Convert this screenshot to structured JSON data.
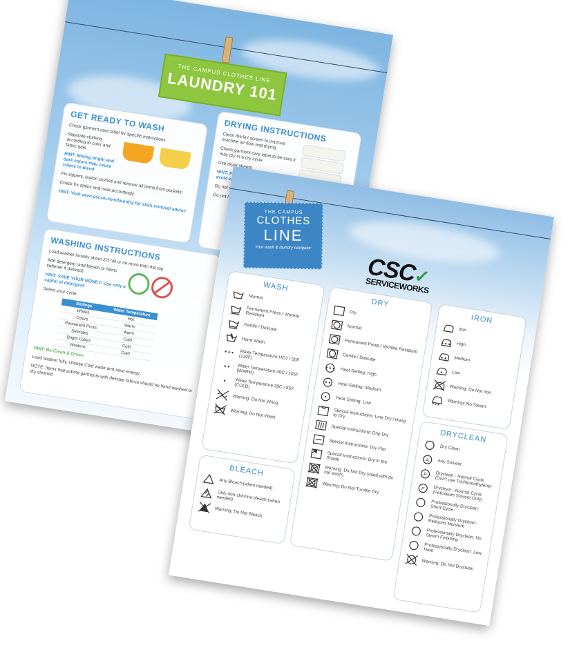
{
  "back_poster": {
    "tag_small": "THE CAMPUS CLOTHES LINE",
    "tag_big": "LAUNDRY 101",
    "get_ready": {
      "title": "GET READY TO WASH",
      "items": [
        "Check garment care label for specific instructions",
        "Separate clothing according to color and fabric type",
        "HINT: Mixing bright and dark colors may cause colors to bleed",
        "Fix zippers, button clothes and remove all items from pockets",
        "Check for stains and treat accordingly",
        "HINT: Visit www.cscsw.com/laundry for stain removal advice"
      ]
    },
    "drying": {
      "title": "DRYING INSTRUCTIONS",
      "items": [
        "Clean the lint screen to improve machine air flow and drying",
        "Check garment care label to be sure it may dry in a dry cycle",
        "Use dryer sheets",
        "HINT: Fold clothes right away to avoid wrinkles",
        "Do not overload the dryer",
        "Do not leave clothes unattended"
      ]
    },
    "washing": {
      "title": "WASHING INSTRUCTIONS",
      "items": [
        "Load washer loosely about 2/3 full or no more than the top",
        "Add detergent (and bleach or fabric softener if desired)",
        "HINT: SAVE YOUR MONEY: Use only a capful of detergent",
        "Select your cycle"
      ],
      "table_headers": [
        "Settings",
        "Water Temperature"
      ],
      "table_rows": [
        [
          "Whites",
          "Hot"
        ],
        [
          "Colors",
          "Warm"
        ],
        [
          "Permanent Press",
          "Warm"
        ],
        [
          "Delicates",
          "Cold"
        ],
        [
          "Bright Colors",
          "Cold"
        ],
        [
          "Woolens",
          "Cold"
        ]
      ],
      "green_hint": "HINT: Be Clean & Green",
      "green_text": "Load washer fully, choose Cold water and save energy",
      "note": "NOTE: Items that submit garments with delicate fabrics should be hand washed or dry cleaned"
    }
  },
  "front_poster": {
    "logo": {
      "line1": "THE CAMPUS",
      "line2": "CLOTHES",
      "line3": "LINE",
      "line4": "Your wash & laundry navigator"
    },
    "brand": {
      "mark": "CSC",
      "sub": "SERVICEWORKS"
    },
    "wash": {
      "title": "WASH",
      "items": [
        {
          "icon": "wash-tub-icon",
          "label": "Normal"
        },
        {
          "icon": "wash-tub-line-icon",
          "label": "Permanent Press / Wrinkle Resistant"
        },
        {
          "icon": "wash-tub-double-line-icon",
          "label": "Gentle / Delicate"
        },
        {
          "icon": "hand-wash-icon",
          "label": "Hand Wash"
        },
        {
          "icon": "three-dots-icon",
          "label": "Water Temperature HOT / 50F (120F)"
        },
        {
          "icon": "two-dots-icon",
          "label": "Water Temperature 40C / 105F (WARM)"
        },
        {
          "icon": "one-dot-icon",
          "label": "Water Temperature 30C / 85F (COLD)"
        },
        {
          "icon": "do-not-wring-icon",
          "label": "Warning: Do Not Wring"
        },
        {
          "icon": "do-not-wash-icon",
          "label": "Warning: Do Not Wash"
        }
      ]
    },
    "bleach": {
      "title": "BLEACH",
      "items": [
        {
          "icon": "triangle-icon",
          "label": "Any Bleach (when needed)"
        },
        {
          "icon": "striped-triangle-icon",
          "label": "Only non-chlorine bleach (when needed)"
        },
        {
          "icon": "crossed-triangle-icon",
          "label": "Warning: Do Not Bleach"
        }
      ]
    },
    "dry": {
      "title": "DRY",
      "items": [
        {
          "icon": "square-icon",
          "label": "Dry"
        },
        {
          "icon": "tumble-dry-icon",
          "label": "Normal"
        },
        {
          "icon": "tumble-dry-line-icon",
          "label": "Permanent Press / Wrinkle Resistant"
        },
        {
          "icon": "tumble-dry-double-line-icon",
          "label": "Gentle / Delicate"
        },
        {
          "icon": "heat-high-icon",
          "label": "Heat Setting: High"
        },
        {
          "icon": "heat-medium-icon",
          "label": "Heat Setting: Medium"
        },
        {
          "icon": "heat-low-icon",
          "label": "Heat Setting: Low"
        },
        {
          "icon": "line-dry-icon",
          "label": "Special Instructions: Line Dry / Hang to Dry"
        },
        {
          "icon": "drip-dry-icon",
          "label": "Special Instructions: Drip Dry"
        },
        {
          "icon": "dry-flat-icon",
          "label": "Special Instructions: Dry Flat"
        },
        {
          "icon": "dry-shade-icon",
          "label": "Special Instructions: Dry in the Shade"
        },
        {
          "icon": "do-not-tumble-icon",
          "label": "Warning: Do Not Dry (used with do not wash)"
        },
        {
          "icon": "do-not-tumble-dry-icon",
          "label": "Warning: Do Not Tumble Dry"
        }
      ]
    },
    "iron": {
      "title": "IRON",
      "items": [
        {
          "icon": "iron-icon",
          "label": "Iron"
        },
        {
          "icon": "iron-high-icon",
          "label": "High"
        },
        {
          "icon": "iron-medium-icon",
          "label": "Medium"
        },
        {
          "icon": "iron-low-icon",
          "label": "Low"
        },
        {
          "icon": "do-not-iron-icon",
          "label": "Warning: Do Not Iron"
        },
        {
          "icon": "no-steam-icon",
          "label": "Warning: No Steam"
        }
      ]
    },
    "dryclean": {
      "title": "DRYCLEAN",
      "items": [
        {
          "icon": "circle-icon",
          "label": "Dry Clean"
        },
        {
          "icon": "circle-a-icon",
          "label": "Any Solvent"
        },
        {
          "icon": "circle-p-icon",
          "label": "Dryclean - Normal Cycle (Don't use Trichloroethylene)"
        },
        {
          "icon": "circle-f-icon",
          "label": "Dryclean - Normal Cycle (Petroleum Solvent Only)"
        },
        {
          "icon": "circle-short-icon",
          "label": "Professionally Dryclean: Short Cycle"
        },
        {
          "icon": "circle-moisture-icon",
          "label": "Professionally Dryclean: Reduced Moisture"
        },
        {
          "icon": "circle-no-steam-icon",
          "label": "Professionally Dryclean: No Steam Finishing"
        },
        {
          "icon": "circle-low-heat-icon",
          "label": "Professionally Dryclean: Low Heat"
        },
        {
          "icon": "do-not-dryclean-icon",
          "label": "Warning: Do Not Dryclean"
        }
      ]
    }
  }
}
